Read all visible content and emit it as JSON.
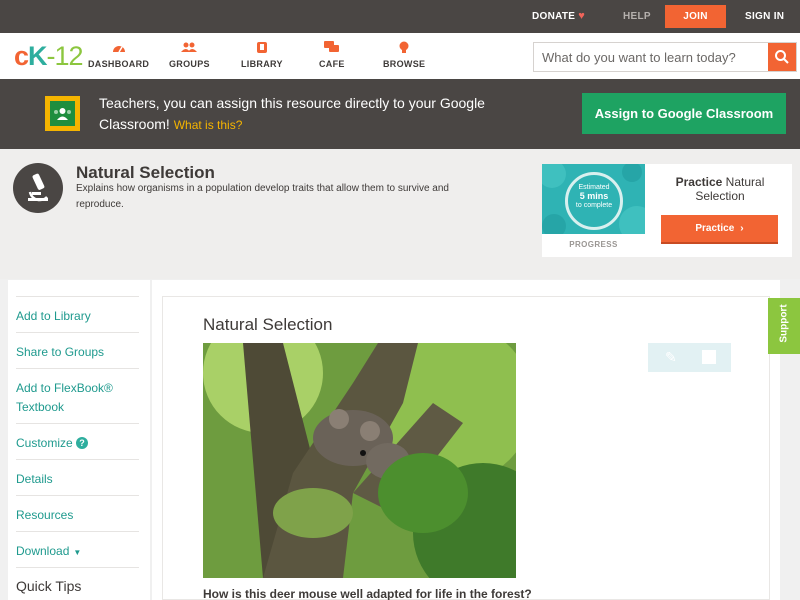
{
  "topbar": {
    "donate": "DONATE",
    "help": "HELP",
    "join": "JOIN",
    "signin": "SIGN IN"
  },
  "nav": {
    "logo": {
      "c": "c",
      "k": "K",
      "n": "-12"
    },
    "items": [
      {
        "label": "DASHBOARD",
        "icon": "dashboard-icon"
      },
      {
        "label": "GROUPS",
        "icon": "groups-icon"
      },
      {
        "label": "LIBRARY",
        "icon": "library-icon"
      },
      {
        "label": "CAFE",
        "icon": "cafe-icon"
      },
      {
        "label": "BROWSE",
        "icon": "browse-icon"
      }
    ],
    "search_placeholder": "What do you want to learn today?"
  },
  "teacher_banner": {
    "message": "Teachers, you can assign this resource directly to your Google Classroom!",
    "what_link": "What is this?",
    "button": "Assign to Google Classroom"
  },
  "concept": {
    "title": "Natural Selection",
    "description": "Explains how organisms in a population develop traits that allow them to survive and reproduce.",
    "practice": {
      "estimated_line1": "Estimated",
      "estimated_line2": "5 mins",
      "estimated_line3": "to complete",
      "progress_label": "PROGRESS",
      "title_bold": "Practice",
      "title_rest": "Natural Selection",
      "button": "Practice"
    }
  },
  "sidebar": {
    "links": [
      {
        "label": "Add to Library"
      },
      {
        "label": "Share to Groups"
      },
      {
        "label": "Add to FlexBook® Textbook"
      },
      {
        "label": "Customize"
      },
      {
        "label": "Details"
      },
      {
        "label": "Resources"
      },
      {
        "label": "Download"
      }
    ],
    "quick_tips": "Quick Tips"
  },
  "article": {
    "title": "Natural Selection",
    "caption": "How is this deer mouse well adapted for life in the forest?"
  },
  "support": "Support",
  "colors": {
    "accent_orange": "#f26433",
    "teal": "#2eae9e",
    "green_button": "#1ea362",
    "dark_bar": "#4a4644",
    "support_green": "#8cc63f"
  }
}
